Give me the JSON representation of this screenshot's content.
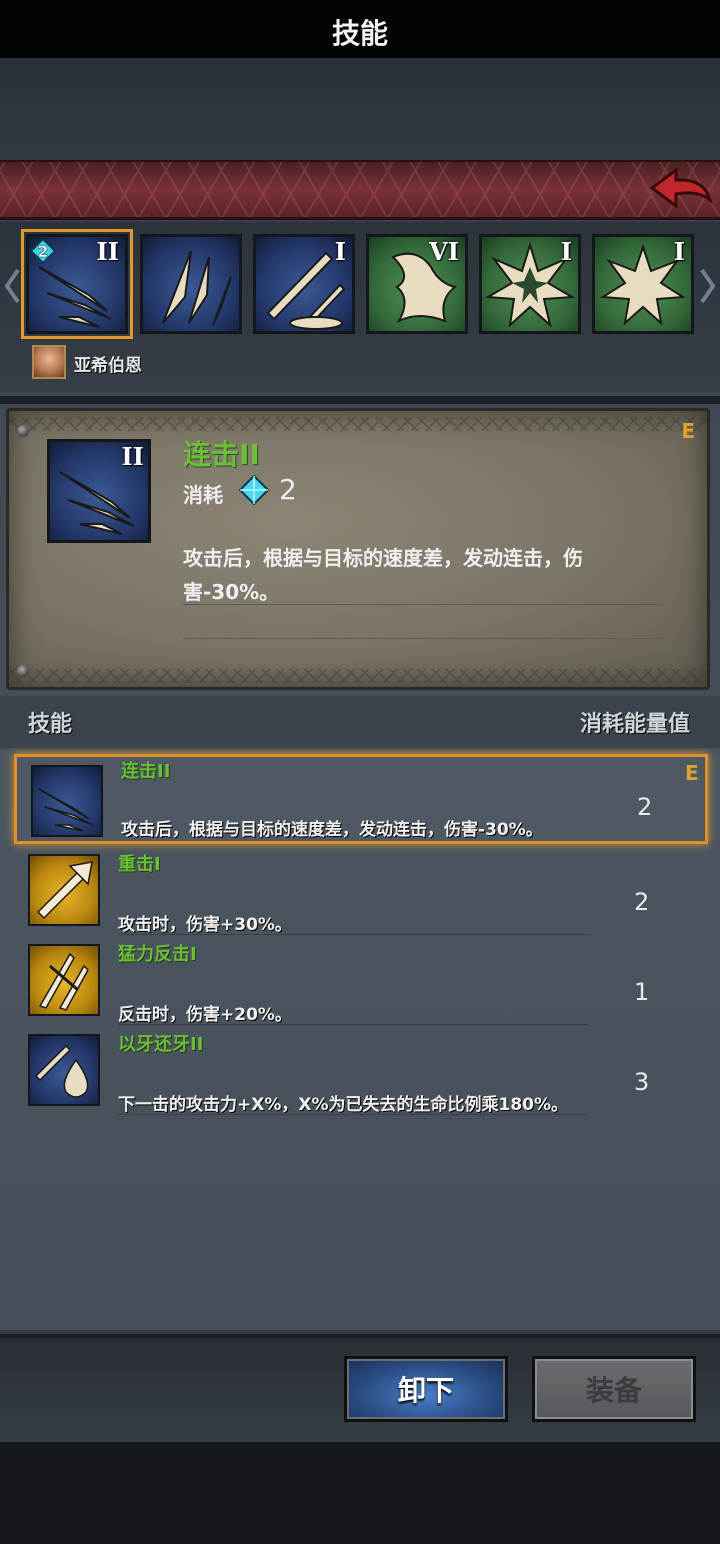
{
  "header": {
    "title": "技能"
  },
  "strip": {
    "slots": [
      {
        "roman": "II",
        "color": "blue",
        "selected": true,
        "cost_badge": "2"
      },
      {
        "roman": "",
        "color": "blue"
      },
      {
        "roman": "I",
        "color": "blue"
      },
      {
        "roman": "VI",
        "color": "green"
      },
      {
        "roman": "I",
        "color": "green"
      },
      {
        "roman": "I",
        "color": "green"
      }
    ],
    "hero_name": "亚希伯恩"
  },
  "detail": {
    "name": "连击II",
    "cost_label": "消耗",
    "cost_value": "2",
    "description": "攻击后，根据与目标的速度差，发动连击，伤害-30%。",
    "tag": "E"
  },
  "list_header": {
    "left": "技能",
    "right": "消耗能量值"
  },
  "skills": [
    {
      "name": "连击II",
      "desc": "攻击后，根据与目标的速度差，发动连击，伤害-30%。",
      "cost": "2",
      "tag": "E",
      "icon": "blue-slash-icon"
    },
    {
      "name": "重击I",
      "desc": "攻击时，伤害+30%。",
      "cost": "2",
      "tag": "",
      "icon": "gold-sword-icon"
    },
    {
      "name": "猛力反击I",
      "desc": "反击时，伤害+20%。",
      "cost": "1",
      "tag": "",
      "icon": "gold-counter-icon"
    },
    {
      "name": "以牙还牙II",
      "desc": "下一击的攻击力+X%，X%为已失去的生命比例乘180%。",
      "cost": "3",
      "tag": "",
      "icon": "blue-blood-icon"
    }
  ],
  "footer": {
    "unequip": "卸下",
    "equip": "装备"
  },
  "colors": {
    "accent_orange": "#e09a2a",
    "skill_green": "#6bbd3a",
    "header_red": "#7a3236"
  }
}
